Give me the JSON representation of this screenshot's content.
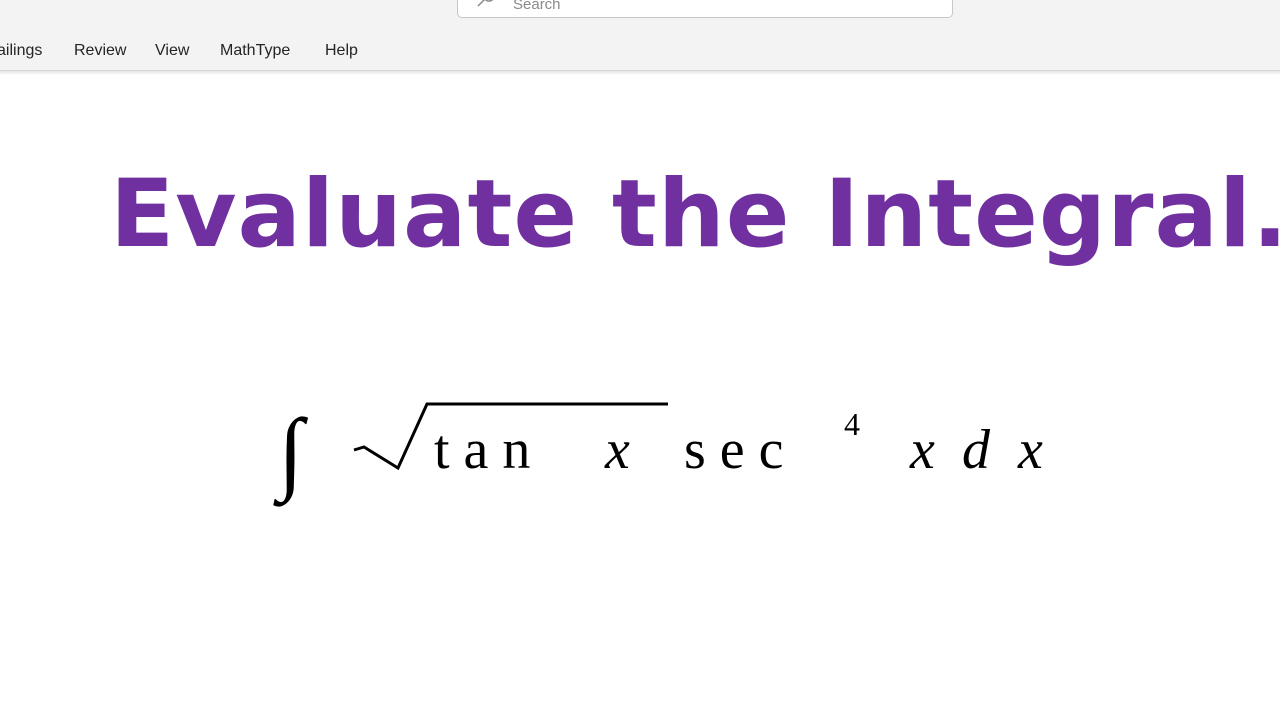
{
  "titlebar": {
    "search_placeholder": "Search"
  },
  "ribbon": {
    "tabs": [
      "ailings",
      "Review",
      "View",
      "MathType",
      "Help"
    ]
  },
  "document": {
    "heading": "Evaluate the Integral.",
    "heading_color": "#7030a0",
    "equation": {
      "integral_sign": "∫",
      "radicand_func": "t a n",
      "radicand_var": "x",
      "func": "s e c",
      "exponent": "4",
      "var": "x",
      "differential_d": "d",
      "differential_var": "x"
    }
  }
}
